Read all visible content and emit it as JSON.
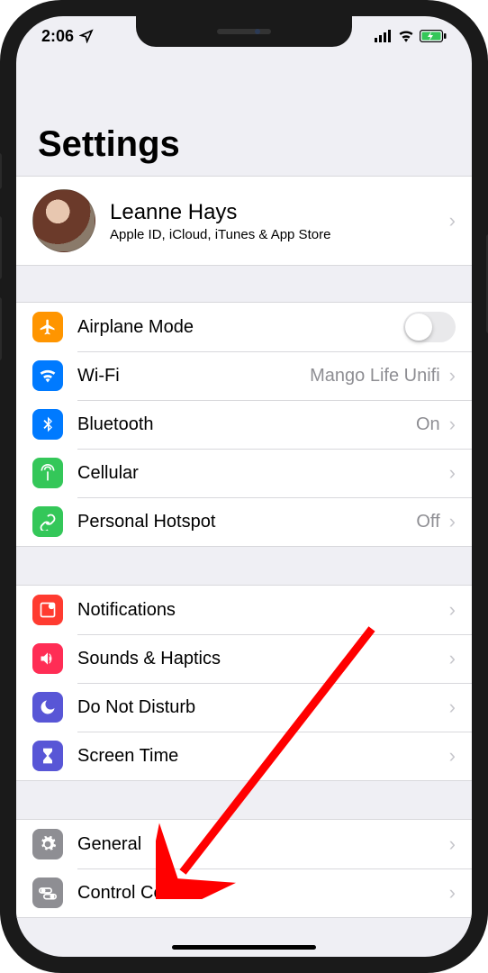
{
  "status": {
    "time": "2:06",
    "location_icon": "location-arrow"
  },
  "page": {
    "title": "Settings"
  },
  "profile": {
    "name": "Leanne Hays",
    "subtitle": "Apple ID, iCloud, iTunes & App Store"
  },
  "groups": [
    {
      "rows": [
        {
          "id": "airplane",
          "label": "Airplane Mode",
          "icon": "airplane",
          "color": "#ff9500",
          "control": "switch",
          "switch": false
        },
        {
          "id": "wifi",
          "label": "Wi-Fi",
          "icon": "wifi",
          "color": "#007aff",
          "detail": "Mango Life Unifi",
          "chevron": true
        },
        {
          "id": "bluetooth",
          "label": "Bluetooth",
          "icon": "bluetooth",
          "color": "#007aff",
          "detail": "On",
          "chevron": true
        },
        {
          "id": "cellular",
          "label": "Cellular",
          "icon": "antenna",
          "color": "#34c759",
          "chevron": true
        },
        {
          "id": "hotspot",
          "label": "Personal Hotspot",
          "icon": "link",
          "color": "#34c759",
          "detail": "Off",
          "chevron": true
        }
      ]
    },
    {
      "rows": [
        {
          "id": "notifications",
          "label": "Notifications",
          "icon": "bell-square",
          "color": "#ff3b30",
          "chevron": true
        },
        {
          "id": "sounds",
          "label": "Sounds & Haptics",
          "icon": "speaker",
          "color": "#ff2d55",
          "chevron": true
        },
        {
          "id": "dnd",
          "label": "Do Not Disturb",
          "icon": "moon",
          "color": "#5856d6",
          "chevron": true
        },
        {
          "id": "screentime",
          "label": "Screen Time",
          "icon": "hourglass",
          "color": "#5856d6",
          "chevron": true
        }
      ]
    },
    {
      "rows": [
        {
          "id": "general",
          "label": "General",
          "icon": "gear",
          "color": "#8e8e93",
          "chevron": true
        },
        {
          "id": "controlcenter",
          "label": "Control Center",
          "icon": "switches",
          "color": "#8e8e93",
          "chevron": true
        }
      ]
    }
  ],
  "annotation": {
    "type": "arrow",
    "color": "#ff0000",
    "target": "general"
  }
}
